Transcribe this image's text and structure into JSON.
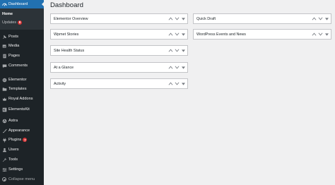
{
  "sidebar": {
    "items": [
      {
        "label": "Dashboard",
        "icon": "dashboard-icon"
      },
      {
        "label": "Posts",
        "icon": "pin-icon"
      },
      {
        "label": "Media",
        "icon": "media-icon"
      },
      {
        "label": "Pages",
        "icon": "page-icon"
      },
      {
        "label": "Comments",
        "icon": "comment-icon"
      },
      {
        "label": "Elementor",
        "icon": "elementor-icon"
      },
      {
        "label": "Templates",
        "icon": "folder-icon"
      },
      {
        "label": "Royal Addons",
        "icon": "royal-addons-icon"
      },
      {
        "label": "ElementsKit",
        "icon": "elementskit-icon"
      },
      {
        "label": "Astra",
        "icon": "astra-icon"
      },
      {
        "label": "Appearance",
        "icon": "brush-icon"
      },
      {
        "label": "Plugins",
        "icon": "plug-icon",
        "badge": "7"
      },
      {
        "label": "Users",
        "icon": "user-icon"
      },
      {
        "label": "Tools",
        "icon": "wrench-icon"
      },
      {
        "label": "Settings",
        "icon": "settings-icon"
      }
    ],
    "submenu": [
      {
        "label": "Home"
      },
      {
        "label": "Updates",
        "badge": "8"
      }
    ],
    "collapse_label": "Collapse menu"
  },
  "main": {
    "title": "Dashboard",
    "left_boxes": [
      {
        "title": "Elementor Overview"
      },
      {
        "title": "Wpmet Stories"
      },
      {
        "title": "Site Health Status"
      },
      {
        "title": "At a Glance"
      },
      {
        "title": "Activity"
      }
    ],
    "right_boxes": [
      {
        "title": "Quick Draft"
      },
      {
        "title": "WordPress Events and News"
      }
    ]
  },
  "colors": {
    "sidebar_bg": "#1d2327",
    "submenu_bg": "#2c3338",
    "accent": "#2271b1",
    "badge": "#d63638",
    "page_bg": "#f0f0f1"
  }
}
